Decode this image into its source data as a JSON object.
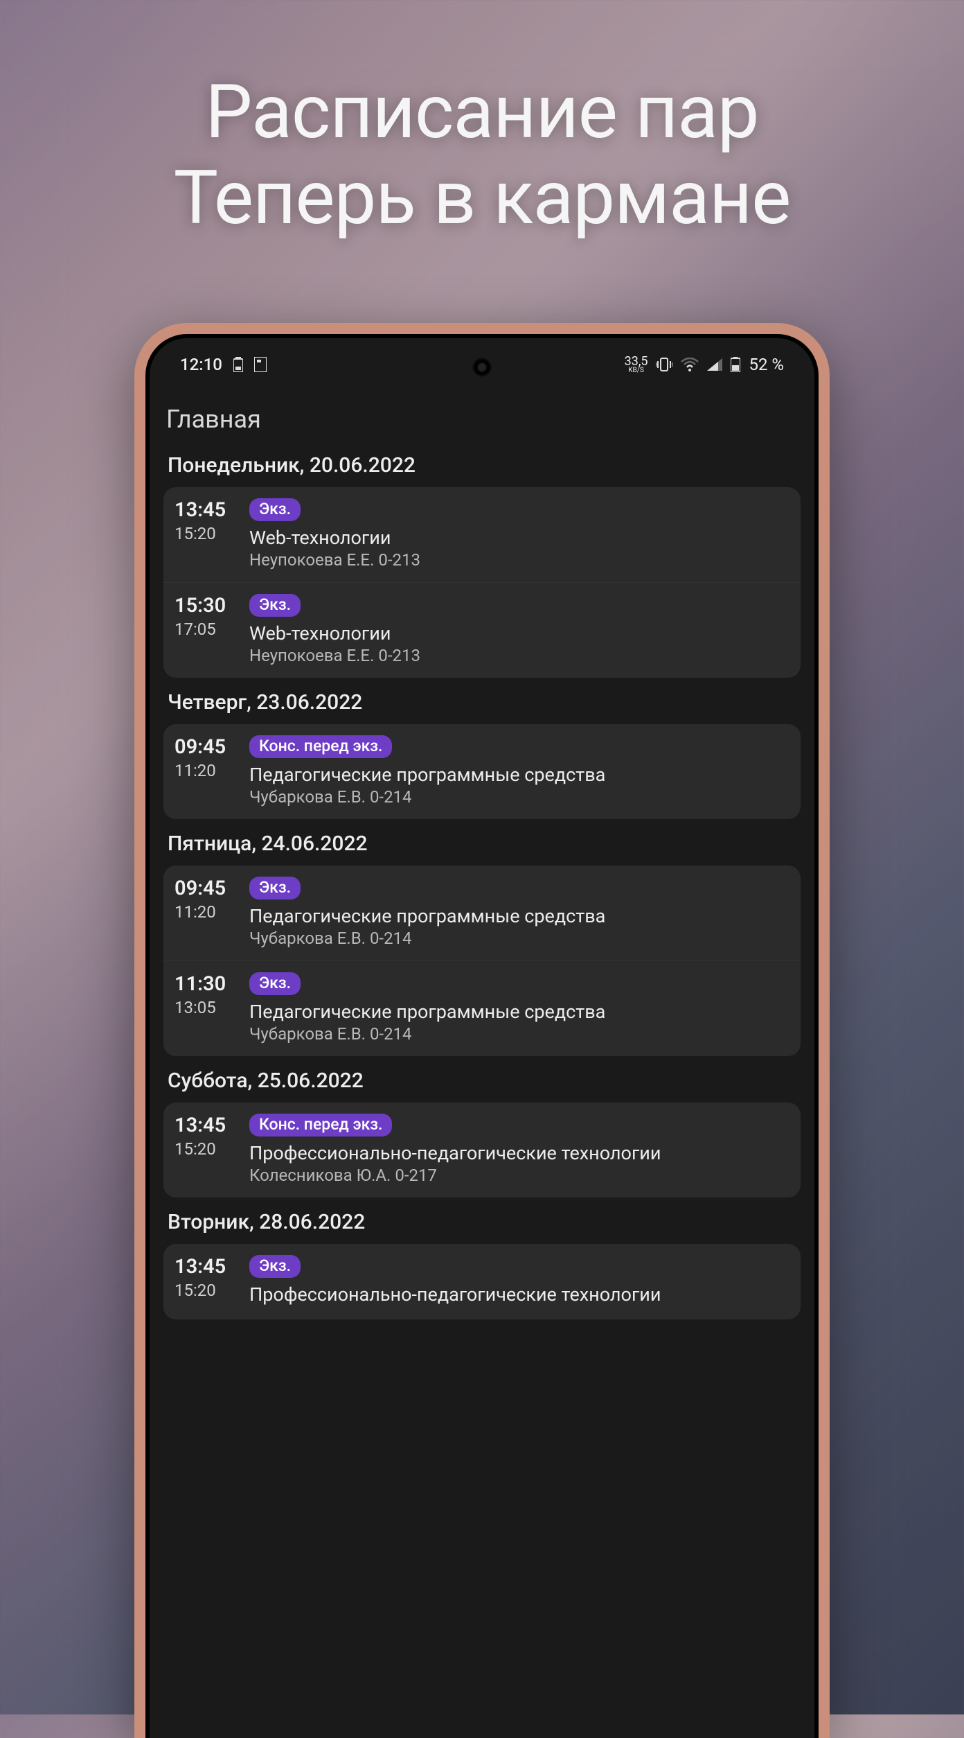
{
  "promo": {
    "line1": "Расписание пар",
    "line2": "Теперь в кармане"
  },
  "status": {
    "time": "12:10",
    "net_speed": "33,5",
    "net_speed_unit": "KB/S",
    "battery_pct": "52 %"
  },
  "app": {
    "title": "Главная"
  },
  "days": [
    {
      "header": "Понедельник, 20.06.2022",
      "lessons": [
        {
          "start": "13:45",
          "end": "15:20",
          "badge": "Экз.",
          "title": "Web-технологии",
          "sub": "Неупокоева Е.Е. 0-213"
        },
        {
          "start": "15:30",
          "end": "17:05",
          "badge": "Экз.",
          "title": "Web-технологии",
          "sub": "Неупокоева Е.Е. 0-213"
        }
      ]
    },
    {
      "header": "Четверг, 23.06.2022",
      "lessons": [
        {
          "start": "09:45",
          "end": "11:20",
          "badge": "Конс. перед экз.",
          "title": "Педагогические программные средства",
          "sub": "Чубаркова Е.В. 0-214"
        }
      ]
    },
    {
      "header": "Пятница, 24.06.2022",
      "lessons": [
        {
          "start": "09:45",
          "end": "11:20",
          "badge": "Экз.",
          "title": "Педагогические программные средства",
          "sub": "Чубаркова Е.В. 0-214"
        },
        {
          "start": "11:30",
          "end": "13:05",
          "badge": "Экз.",
          "title": "Педагогические программные средства",
          "sub": "Чубаркова Е.В. 0-214"
        }
      ]
    },
    {
      "header": "Суббота, 25.06.2022",
      "lessons": [
        {
          "start": "13:45",
          "end": "15:20",
          "badge": "Конс. перед экз.",
          "title": "Профессионально-педагогические технологии",
          "sub": "Колесникова Ю.А. 0-217"
        }
      ]
    },
    {
      "header": "Вторник, 28.06.2022",
      "lessons": [
        {
          "start": "13:45",
          "end": "15:20",
          "badge": "Экз.",
          "title": "Профессионально-педагогические технологии",
          "sub": ""
        }
      ]
    }
  ]
}
